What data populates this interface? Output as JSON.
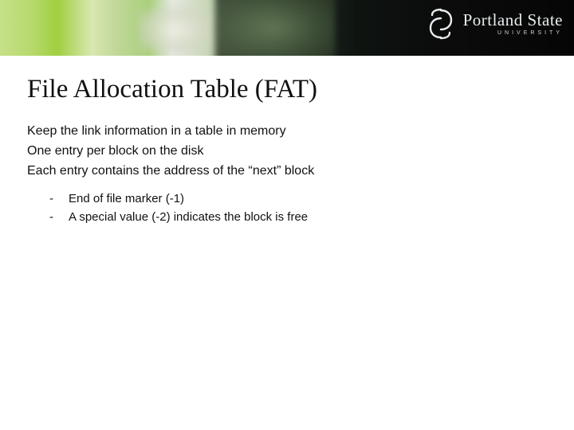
{
  "logo": {
    "name_line1": "Portland State",
    "name_line2": "UNIVERSITY"
  },
  "title": "File Allocation Table (FAT)",
  "body": {
    "lines": [
      "Keep the link information in a table in memory",
      "One entry per block on the disk",
      "Each entry contains the address of the “next” block"
    ],
    "sublist": [
      "End of file marker (-1)",
      "A special value (-2) indicates the block is free"
    ]
  }
}
